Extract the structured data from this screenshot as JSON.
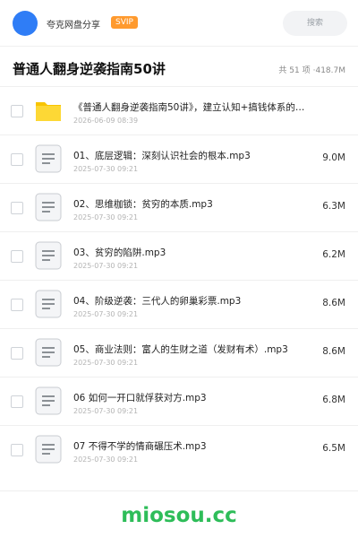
{
  "header": {
    "share_name": "夸克网盘分享",
    "badge": "SVIP",
    "search_placeholder": "搜索",
    "avatar_color": "#2f7df6",
    "badge_color": "#ff9a2e"
  },
  "folder": {
    "title": "普通人翻身逆袭指南50讲",
    "count": "共 51 项",
    "size": "418.7M"
  },
  "files": [
    {
      "icon": "folder-icon",
      "name": "《普通人翻身逆袭指南50讲》，建立认知+搞钱体系的…",
      "date": "2026-06-09 08:39",
      "size": ""
    },
    {
      "icon": "audio-file-icon",
      "name": "01、底层逻辑：深刻认识社会的根本.mp3",
      "date": "2025-07-30 09:21",
      "size": "9.0M"
    },
    {
      "icon": "audio-file-icon",
      "name": "02、思维枷锁：贫穷的本质.mp3",
      "date": "2025-07-30 09:21",
      "size": "6.3M"
    },
    {
      "icon": "audio-file-icon",
      "name": "03、贫穷的陷阱.mp3",
      "date": "2025-07-30 09:21",
      "size": "6.2M"
    },
    {
      "icon": "audio-file-icon",
      "name": "04、阶级逆袭：三代人的卵巢彩票.mp3",
      "date": "2025-07-30 09:21",
      "size": "8.6M"
    },
    {
      "icon": "audio-file-icon",
      "name": "05、商业法则：富人的生财之道（发财有术）.mp3",
      "date": "2025-07-30 09:21",
      "size": "8.6M"
    },
    {
      "icon": "audio-file-icon",
      "name": "06 如何一开口就俘获对方.mp3",
      "date": "2025-07-30 09:21",
      "size": "6.8M"
    },
    {
      "icon": "audio-file-icon",
      "name": "07 不得不学的情商碾压术.mp3",
      "date": "2025-07-30 09:21",
      "size": "6.5M"
    }
  ],
  "watermark": "miosou.cc"
}
